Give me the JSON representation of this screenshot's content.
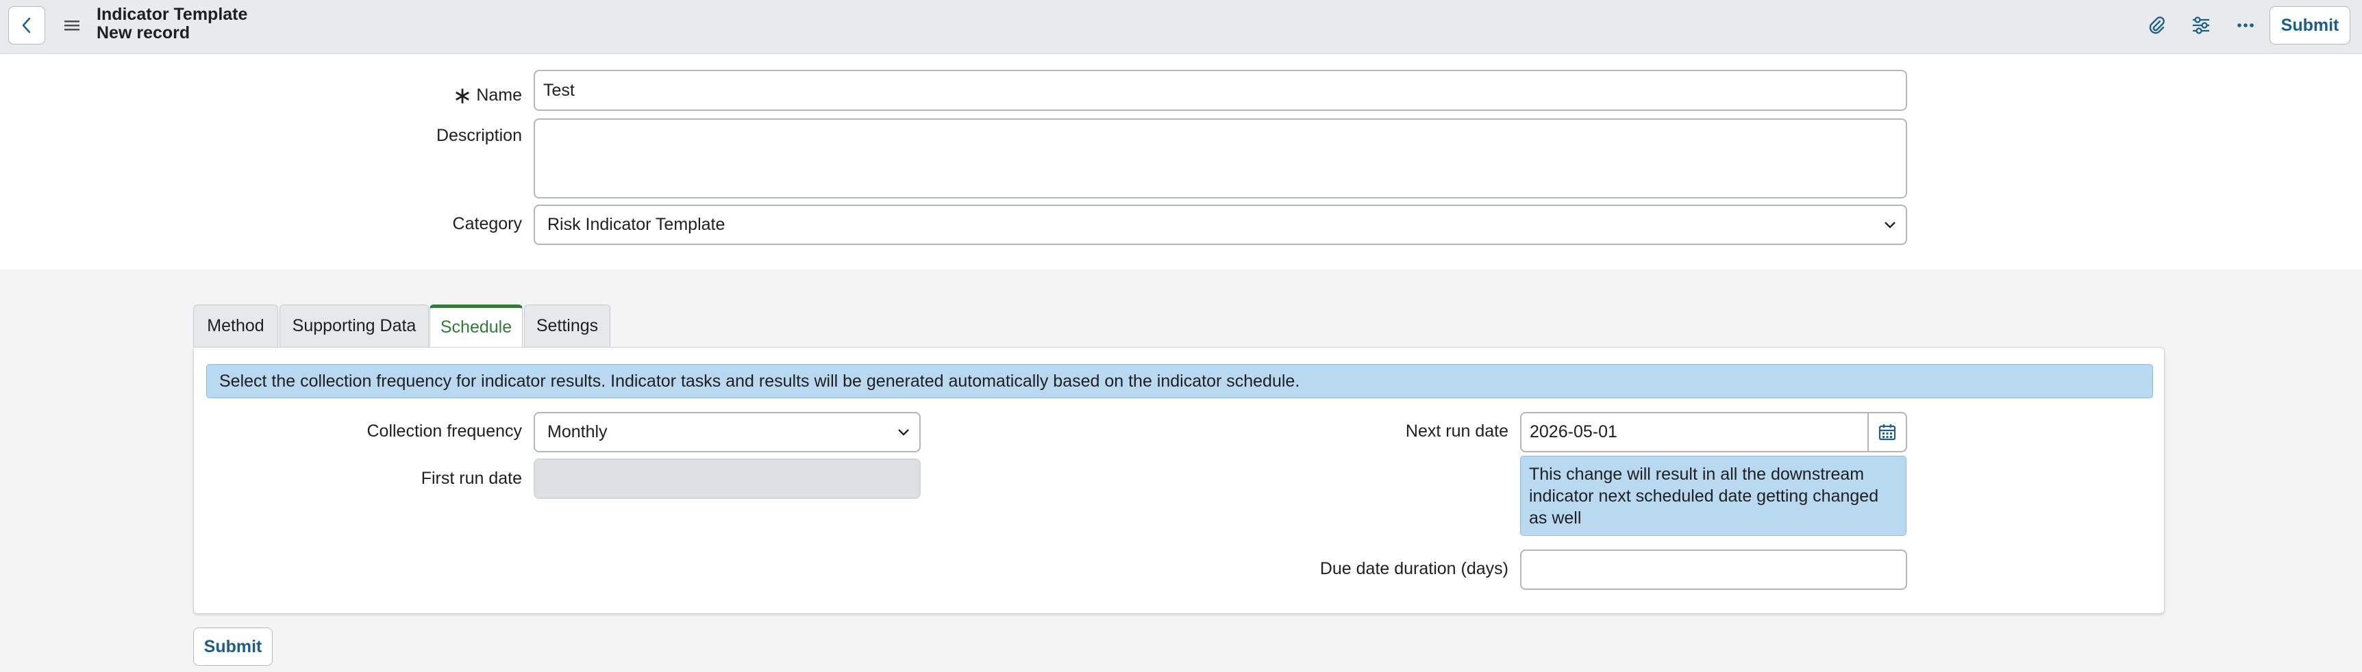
{
  "header": {
    "title": "Indicator Template",
    "subtitle": "New record",
    "submit_label": "Submit",
    "icons": [
      "back-icon",
      "menu-icon",
      "paperclip-icon",
      "settings-sliders-icon",
      "more-options-icon"
    ]
  },
  "form": {
    "name_label": "Name",
    "name_value": "Test",
    "required_mark": "∗",
    "description_label": "Description",
    "description_value": "",
    "category_label": "Category",
    "category_value": "Risk Indicator Template"
  },
  "tabs": [
    {
      "label": "Method"
    },
    {
      "label": "Supporting Data"
    },
    {
      "label": "Schedule",
      "active": true
    },
    {
      "label": "Settings"
    }
  ],
  "schedule": {
    "info_text": "Select the collection frequency for indicator results. Indicator tasks and results will be generated automatically based on the indicator schedule.",
    "collection_frequency_label": "Collection frequency",
    "collection_frequency_value": "Monthly",
    "first_run_date_label": "First run date",
    "first_run_date_value": "",
    "next_run_date_label": "Next run date",
    "next_run_date_value": "2026-05-01",
    "next_run_note": "This change will result in all the downstream indicator next scheduled date getting changed as well",
    "due_date_label": "Due date duration (days)",
    "due_date_value": ""
  },
  "footer": {
    "submit_label": "Submit"
  },
  "colors": {
    "accent_green": "#2e7d32",
    "link_blue": "#1a5f8a",
    "info_bg": "#b9d9f0"
  }
}
